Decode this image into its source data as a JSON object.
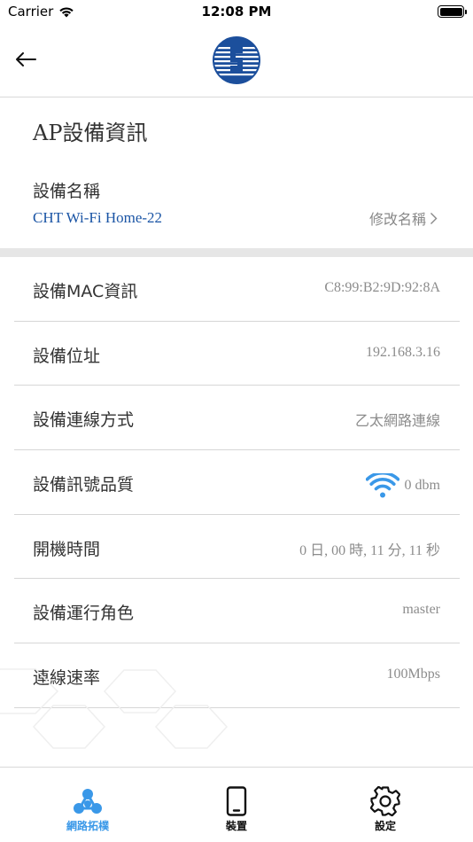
{
  "status_bar": {
    "carrier": "Carrier",
    "time": "12:08 PM",
    "icons": [
      "wifi-icon",
      "battery-icon"
    ]
  },
  "nav": {
    "back_icon": "arrow-left-icon",
    "logo": "cht-logo"
  },
  "section": {
    "title": "AP設備資訊"
  },
  "device_name": {
    "label": "設備名稱",
    "value": "CHT Wi-Fi Home-22",
    "action": "修改名稱"
  },
  "rows": [
    {
      "label": "設備MAC資訊",
      "value": "C8:99:B2:9D:92:8A"
    },
    {
      "label": "設備位址",
      "value": "192.168.3.16"
    },
    {
      "label": "設備連線方式",
      "value": "乙太網路連線"
    },
    {
      "label": "設備訊號品質",
      "value": "0 dbm",
      "icon": "wifi-signal-icon"
    },
    {
      "label": "開機時間",
      "value": "0 日, 00 時, 11 分, 11 秒"
    },
    {
      "label": "設備運行角色",
      "value": "master"
    },
    {
      "label": "連線速率",
      "value": "100Mbps"
    }
  ],
  "tabs": [
    {
      "label": "網路拓樸",
      "icon": "network-topology-icon",
      "active": true
    },
    {
      "label": "裝置",
      "icon": "phone-device-icon",
      "active": false
    },
    {
      "label": "設定",
      "icon": "gear-icon",
      "active": false
    }
  ],
  "colors": {
    "accent": "#3a98e8",
    "link": "#1b55a5",
    "logo_blue": "#1c4f9c",
    "separator": "#e6e6e6"
  }
}
